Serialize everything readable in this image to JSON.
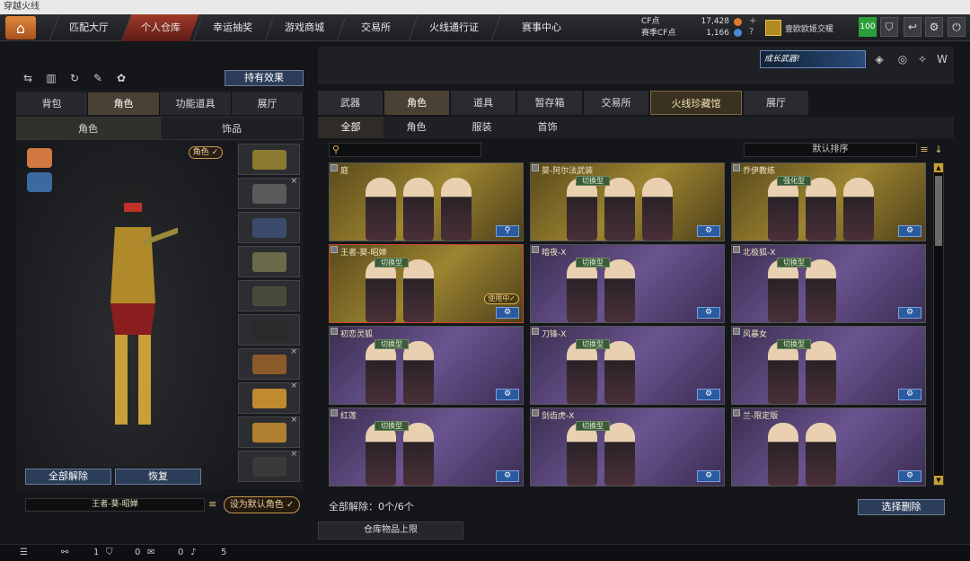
{
  "window": {
    "title": "穿越火线"
  },
  "topnav": {
    "tabs": [
      "匹配大厅",
      "个人仓库",
      "幸运抽奖",
      "游戏商城",
      "交易所",
      "火线通行证",
      "赛事中心"
    ],
    "active": 1,
    "cf_label": "CF点",
    "cf_value": "17,428",
    "cf2_label": "赛季CF点",
    "cf2_value": "1,166",
    "user": "壹欧欧姬交暖",
    "level": "100"
  },
  "left": {
    "effect_button": "持有效果",
    "tabs": [
      "背包",
      "角色",
      "功能道具",
      "展厅"
    ],
    "subtabs": [
      "角色",
      "饰品"
    ],
    "badge": "角色 ✓",
    "clear_all": "全部解除",
    "restore": "恢复",
    "char_name": "王者-葵-昭婵",
    "set_default": "设为默认角色 ✓"
  },
  "right": {
    "tabs": [
      "武器",
      "角色",
      "道具",
      "暂存箱",
      "交易所",
      "火线珍藏馆",
      "展厅"
    ],
    "subtabs": [
      "全部",
      "角色",
      "服装",
      "首饰"
    ],
    "sort": "默认排序",
    "footer": "全部解除：0个/6个",
    "clear_selected": "选择删除",
    "storage": "仓库物品上限"
  },
  "promo": {
    "banner": "成长武器!"
  },
  "cards": [
    {
      "name": "庭",
      "tag": "",
      "style": "gold"
    },
    {
      "name": "葵-阿尔法武装",
      "tag": "切换型",
      "style": "gold"
    },
    {
      "name": "乔伊教练",
      "tag": "强化型",
      "style": "gold"
    },
    {
      "name": "王者-葵-昭婵",
      "tag": "切换型",
      "style": "gold",
      "using": "使用中✓"
    },
    {
      "name": "暗夜-X",
      "tag": "切换型",
      "style": "purple"
    },
    {
      "name": "北极狐-X",
      "tag": "切换型",
      "style": "purple"
    },
    {
      "name": "初恋灵狐",
      "tag": "切换型",
      "style": "purple"
    },
    {
      "name": "刀锋-X",
      "tag": "切换型",
      "style": "purple"
    },
    {
      "name": "风暴女",
      "tag": "切换型",
      "style": "purple"
    },
    {
      "name": "红莲",
      "tag": "切换型",
      "style": "purple"
    },
    {
      "name": "剑齿虎-X",
      "tag": "切换型",
      "style": "purple"
    },
    {
      "name": "兰-限定版",
      "tag": "",
      "style": "purple"
    }
  ],
  "bottom": {
    "v1": "1",
    "v2": "0",
    "v3": "0",
    "v4": "5"
  }
}
